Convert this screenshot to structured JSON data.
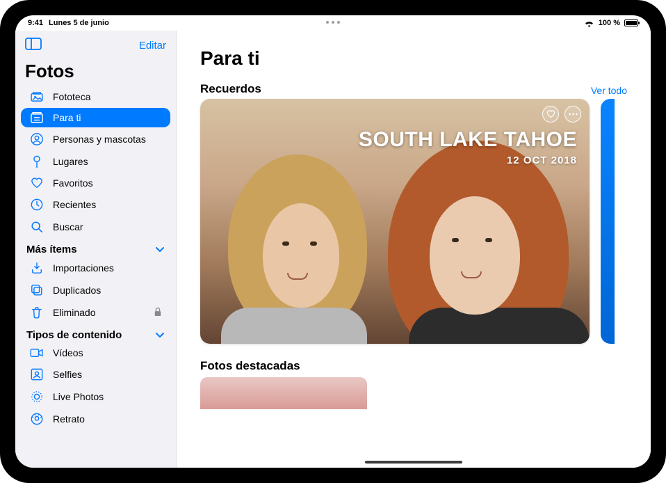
{
  "status": {
    "time": "9:41",
    "date": "Lunes 5 de junio",
    "battery_text": "100 %"
  },
  "sidebar": {
    "edit_label": "Editar",
    "app_title": "Fotos",
    "sections": {
      "more_items": "Más ítems",
      "content_types": "Tipos de contenido"
    },
    "items": {
      "library": "Fototeca",
      "for_you": "Para ti",
      "people_pets": "Personas y mascotas",
      "places": "Lugares",
      "favorites": "Favoritos",
      "recents": "Recientes",
      "search": "Buscar",
      "imports": "Importaciones",
      "duplicates": "Duplicados",
      "deleted": "Eliminado",
      "videos": "Vídeos",
      "selfies": "Selfies",
      "live_photos": "Live Photos",
      "portrait": "Retrato"
    }
  },
  "main": {
    "page_title": "Para ti",
    "memories": {
      "header": "Recuerdos",
      "see_all": "Ver todo",
      "card": {
        "title": "SOUTH LAKE TAHOE",
        "date": "12 OCT 2018"
      }
    },
    "featured": {
      "header": "Fotos destacadas"
    }
  }
}
